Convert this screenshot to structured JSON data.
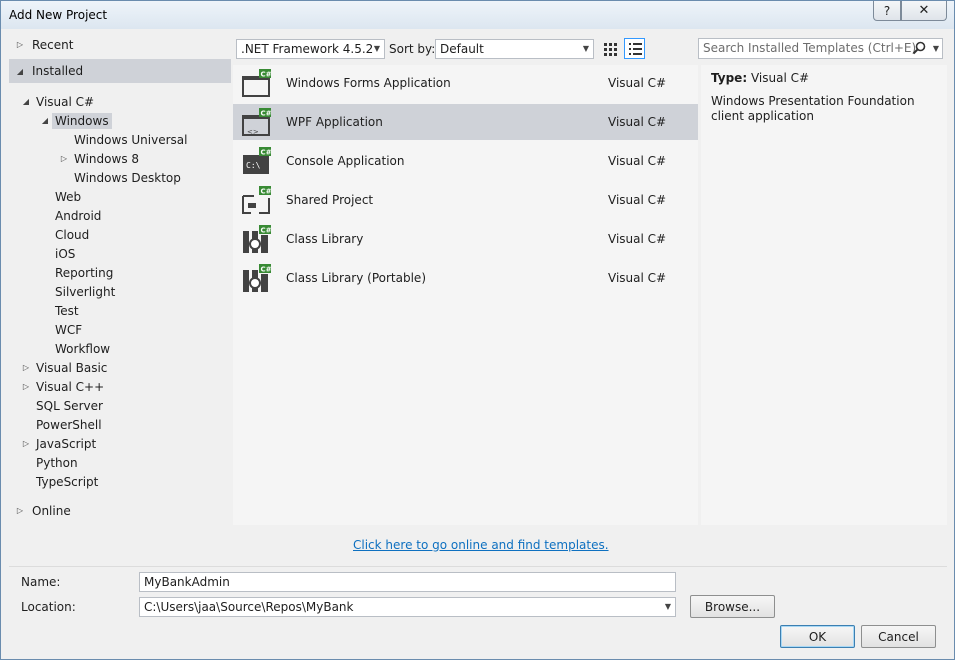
{
  "window": {
    "title": "Add New Project",
    "help_label": "?",
    "close_label": "✕"
  },
  "tree": {
    "recent": "Recent",
    "installed": "Installed",
    "visual_csharp": "Visual C#",
    "windows": "Windows",
    "windows_universal": "Windows Universal",
    "windows8": "Windows 8",
    "windows_desktop": "Windows Desktop",
    "web": "Web",
    "android": "Android",
    "cloud": "Cloud",
    "ios": "iOS",
    "reporting": "Reporting",
    "silverlight": "Silverlight",
    "test": "Test",
    "wcf": "WCF",
    "workflow": "Workflow",
    "visual_basic": "Visual Basic",
    "visual_cpp": "Visual C++",
    "sql_server": "SQL Server",
    "powershell": "PowerShell",
    "javascript": "JavaScript",
    "python": "Python",
    "typescript": "TypeScript",
    "online": "Online"
  },
  "toolbar": {
    "framework": ".NET Framework 4.5.2",
    "sort_label": "Sort by:",
    "sort_value": "Default",
    "search_placeholder": "Search Installed Templates (Ctrl+E)"
  },
  "templates": [
    {
      "name": "Windows Forms Application",
      "lang": "Visual C#"
    },
    {
      "name": "WPF Application",
      "lang": "Visual C#"
    },
    {
      "name": "Console Application",
      "lang": "Visual C#"
    },
    {
      "name": "Shared Project",
      "lang": "Visual C#"
    },
    {
      "name": "Class Library",
      "lang": "Visual C#"
    },
    {
      "name": "Class Library (Portable)",
      "lang": "Visual C#"
    }
  ],
  "details": {
    "type_label": "Type:",
    "type_value": "Visual C#",
    "description": "Windows Presentation Foundation client application"
  },
  "online_link": "Click here to go online and find templates.",
  "form": {
    "name_label": "Name:",
    "name_value": "MyBankAdmin",
    "location_label": "Location:",
    "location_value": "C:\\Users\\jaa\\Source\\Repos\\MyBank",
    "browse_label": "Browse...",
    "ok_label": "OK",
    "cancel_label": "Cancel"
  },
  "colors": {
    "selection": "#cfd2d8",
    "link": "#0e70c0",
    "csharp_badge": "#388a34"
  }
}
